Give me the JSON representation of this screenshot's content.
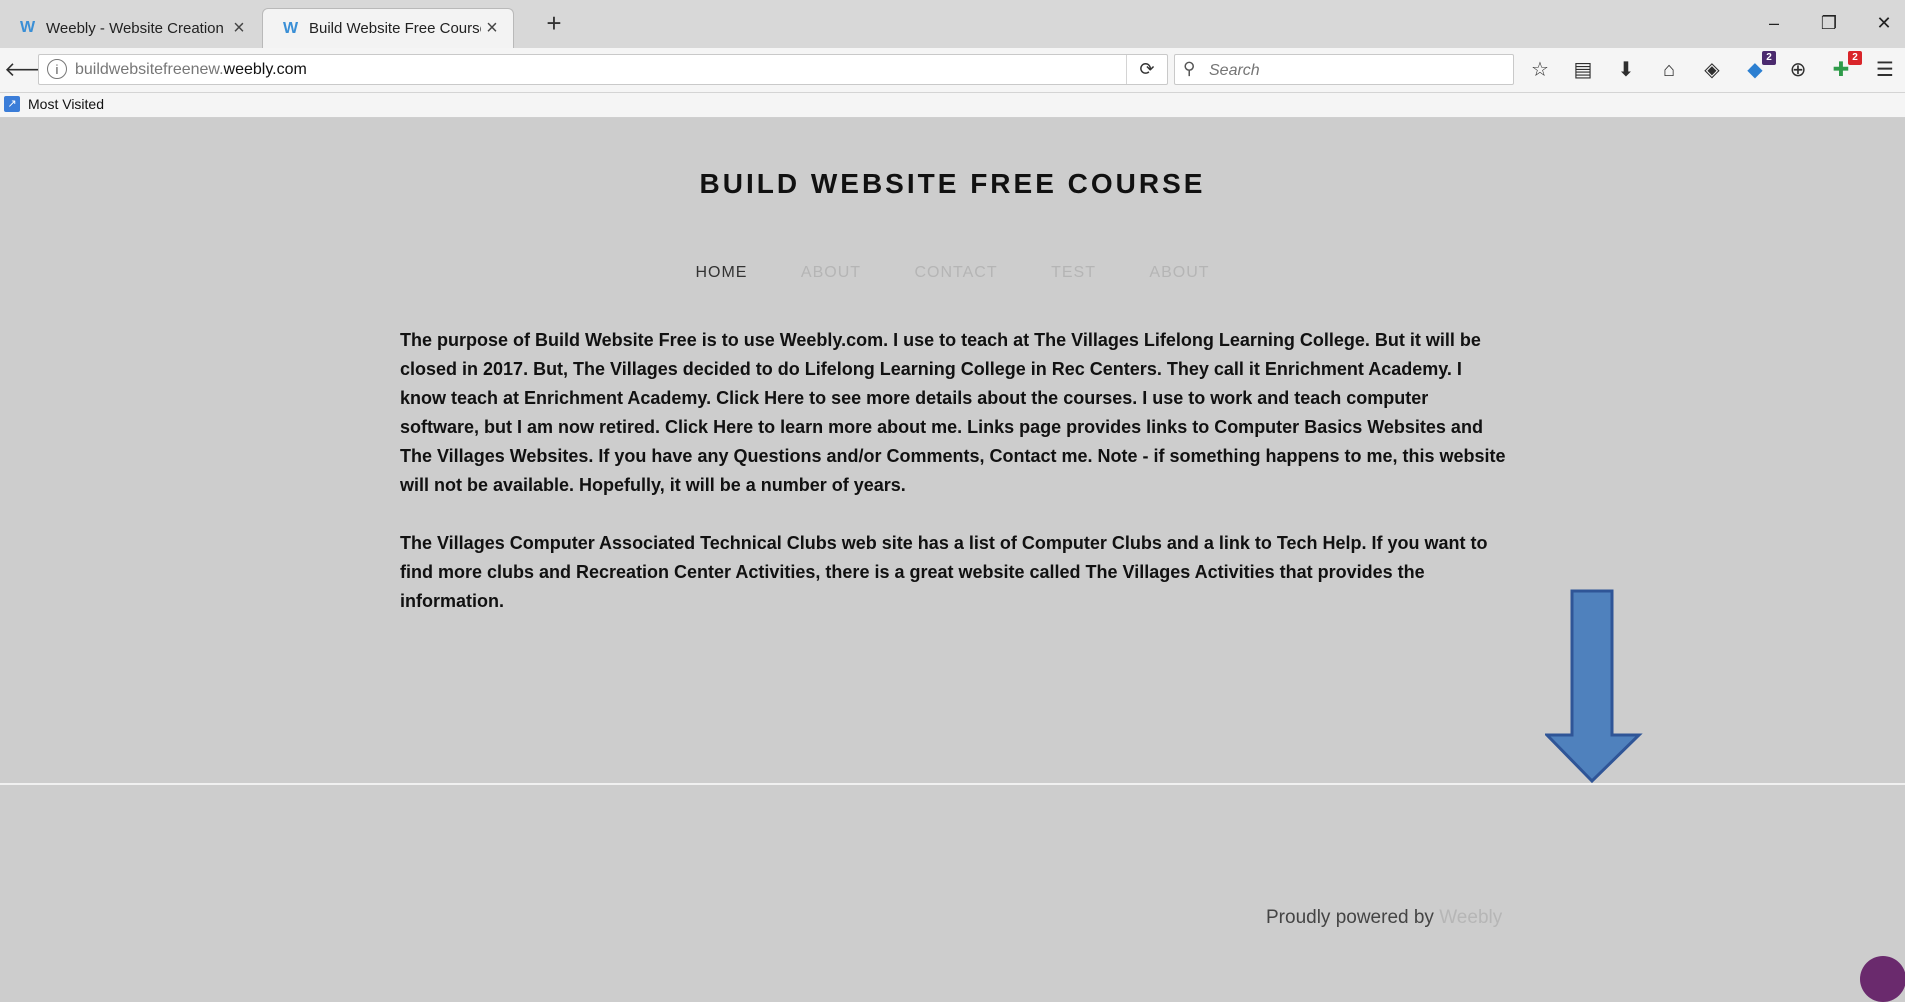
{
  "browser": {
    "tabs": [
      {
        "title": "Weebly - Website Creation M",
        "favicon": "weebly-logo-icon",
        "active": false
      },
      {
        "title": "Build Website Free Course - ",
        "favicon": "weebly-logo-icon",
        "active": true
      }
    ],
    "new_tab_label": "+",
    "url_prefix": "buildwebsitefreenew.",
    "url_domain": "weebly.com",
    "search_placeholder": "Search",
    "toolbar_badges": {
      "notifications": "2",
      "extension": "2"
    },
    "bookmarks": [
      {
        "label": "Most Visited"
      }
    ]
  },
  "site": {
    "title": "BUILD WEBSITE FREE COURSE",
    "nav": [
      {
        "label": "HOME",
        "active": true
      },
      {
        "label": "ABOUT",
        "active": false
      },
      {
        "label": "CONTACT",
        "active": false
      },
      {
        "label": "TEST",
        "active": false
      },
      {
        "label": "ABOUT",
        "active": false
      }
    ],
    "paragraphs": [
      "The purpose of Build Website Free is to use Weebly.com.  I use to teach at The Villages Lifelong Learning College. But it will be closed in 2017.  But, The Villages decided to do Lifelong Learning College in Rec Centers.  They call it Enrichment Academy. I know teach at Enrichment Academy.  Click Here to see more details about the courses.  I use to work and teach computer software, but I am now retired.  Click Here to learn more about me.  Links page provides links to Computer Basics Websites and The Villages Websites.  If you have any Questions and/or Comments, Contact me. Note - if something happens to me, this website will not be available.  Hopefully, it will be a number of years.",
      "The Villages Computer  Associated Technical Clubs web site has a list of Computer Clubs and a link to Tech Help.  If you want to find more clubs and Recreation Center Activities, there is a great website called The Villages Activities that provides the information."
    ],
    "footer_prefix": "Proudly powered by ",
    "footer_link": "Weebly"
  },
  "colors": {
    "page_background": "#cdcdcd",
    "arrow_fill": "#4f81bd",
    "arrow_stroke": "#2f5597"
  }
}
